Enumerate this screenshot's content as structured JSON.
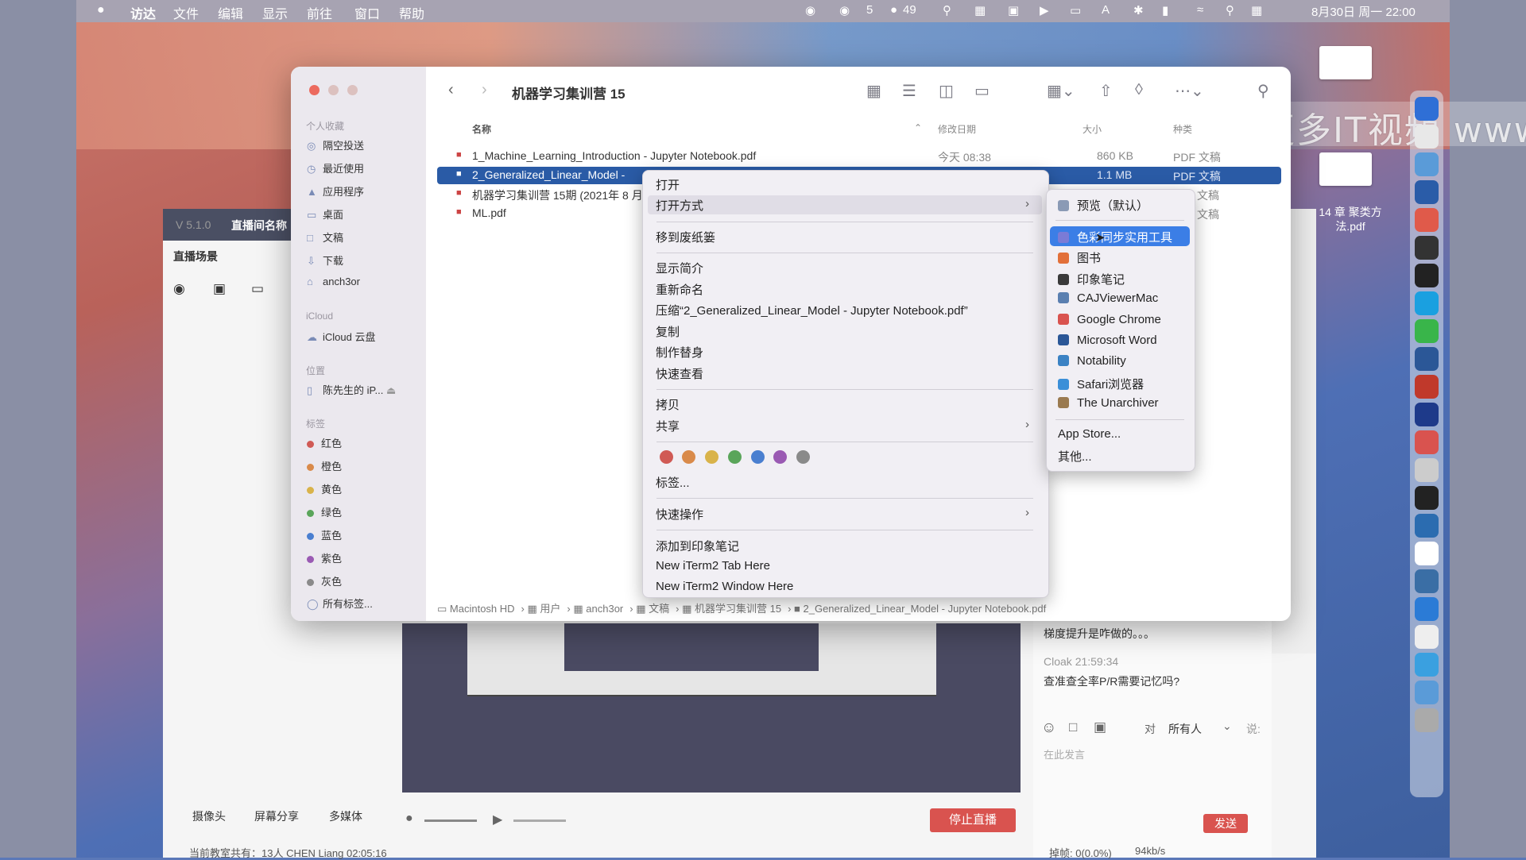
{
  "menubar": {
    "items": [
      "访达",
      "文件",
      "编辑",
      "显示",
      "前往",
      "窗口",
      "帮助"
    ],
    "tray": {
      "wechat_count": "5",
      "badge_count": "49"
    },
    "datetime": "8月30日 周一 22:00"
  },
  "finder": {
    "title": "机器学习集训营 15",
    "sidebar": {
      "favorites_header": "个人收藏",
      "favorites": [
        "隔空投送",
        "最近使用",
        "应用程序",
        "桌面",
        "文稿",
        "下载",
        "anch3or"
      ],
      "icloud_header": "iCloud",
      "icloud": [
        "iCloud 云盘"
      ],
      "locations_header": "位置",
      "locations": [
        "陈先生的 iP..."
      ],
      "tags_header": "标签",
      "tags": [
        {
          "name": "红色",
          "color": "#d05a55"
        },
        {
          "name": "橙色",
          "color": "#d98a4a"
        },
        {
          "name": "黄色",
          "color": "#d9b34a"
        },
        {
          "name": "绿色",
          "color": "#5aa55a"
        },
        {
          "name": "蓝色",
          "color": "#4a7fd0"
        },
        {
          "name": "紫色",
          "color": "#9a5ab3"
        },
        {
          "name": "灰色",
          "color": "#8a8a8a"
        }
      ],
      "all_tags": "所有标签..."
    },
    "columns": {
      "name": "名称",
      "date": "修改日期",
      "size": "大小",
      "kind": "种类"
    },
    "files": [
      {
        "name": "1_Machine_Learning_Introduction - Jupyter Notebook.pdf",
        "date": "今天 08:38",
        "size": "860 KB",
        "kind": "PDF 文稿"
      },
      {
        "name": "2_Generalized_Linear_Model -",
        "date": "",
        "size": "1.1 MB",
        "kind": "PDF 文稿"
      },
      {
        "name": "机器学习集训营 15期 (2021年 8 月",
        "date": "",
        "size": "",
        "kind": "文稿"
      },
      {
        "name": "ML.pdf",
        "date": "",
        "size": "",
        "kind": "文稿"
      }
    ],
    "pathbar": [
      "Macintosh HD",
      "用户",
      "anch3or",
      "文稿",
      "机器学习集训营 15",
      "2_Generalized_Linear_Model - Jupyter Notebook.pdf"
    ]
  },
  "context_menu": {
    "open": "打开",
    "open_with": "打开方式",
    "trash": "移到废纸篓",
    "get_info": "显示简介",
    "rename": "重新命名",
    "compress": "压缩“2_Generalized_Linear_Model - Jupyter Notebook.pdf”",
    "duplicate": "复制",
    "alias": "制作替身",
    "quicklook": "快速查看",
    "copy": "拷贝",
    "share": "共享",
    "tag_colors": [
      "#d05a55",
      "#d98a4a",
      "#d9b34a",
      "#5aa55a",
      "#4a7fd0",
      "#9a5ab3",
      "#8a8a8a"
    ],
    "tags": "标签...",
    "quick_actions": "快速操作",
    "add_evernote": "添加到印象笔记",
    "iterm_tab": "New iTerm2 Tab Here",
    "iterm_window": "New iTerm2 Window Here"
  },
  "submenu": {
    "default_app": "预览（默认）",
    "apps": [
      {
        "name": "色彩同步实用工具",
        "color": "#7b7bd6"
      },
      {
        "name": "图书",
        "color": "#e2703a"
      },
      {
        "name": "印象笔记",
        "color": "#3a3a3a"
      },
      {
        "name": "CAJViewerMac",
        "color": "#5a7fb0"
      },
      {
        "name": "Google Chrome",
        "color": "#d9534f"
      },
      {
        "name": "Microsoft Word",
        "color": "#2b5797"
      },
      {
        "name": "Notability",
        "color": "#3b82c4"
      },
      {
        "name": "Safari浏览器",
        "color": "#3b8fd8"
      },
      {
        "name": "The Unarchiver",
        "color": "#9a7a50"
      }
    ],
    "app_store": "App Store...",
    "other": "其他..."
  },
  "watermark": "更多IT视频 www",
  "desktop": {
    "file_label": "14 章 聚类方法.pdf"
  },
  "stream_app": {
    "version": "V 5.1.0",
    "room_name": "直播间名称",
    "scene": "直播场景",
    "bottom_tabs": [
      "摄像头",
      "屏幕分享",
      "多媒体"
    ],
    "stop_live": "停止直播",
    "send": "发送",
    "status": "当前教室共有：13人",
    "teacher": "CHEN Liang",
    "time": "02:05:16",
    "drop": "掉帧: 0(0.0%)",
    "rate": "94kb/s",
    "chat": {
      "msg1": "梯度提升是咋做的。。。",
      "user": "Cloak",
      "msg_time": "21:59:34",
      "msg2": "查准查全率P/R需要记忆吗?",
      "to": "对",
      "audience": "所有人",
      "say": "说:",
      "placeholder": "在此发言"
    }
  }
}
